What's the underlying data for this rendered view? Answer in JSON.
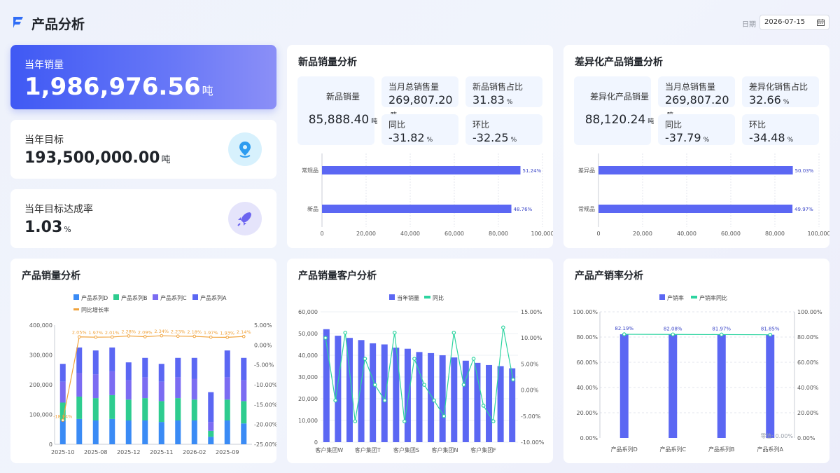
{
  "header": {
    "title": "产品分析",
    "date_label": "日期",
    "date_value": "2026-07-15"
  },
  "kpis": {
    "annual_sales": {
      "label": "当年销量",
      "value": "1,986,976.56",
      "unit": "吨"
    },
    "annual_target": {
      "label": "当年目标",
      "value": "193,500,000.00",
      "unit": "吨"
    },
    "target_rate": {
      "label": "当年目标达成率",
      "value": "1.03",
      "unit": "%"
    }
  },
  "new_product": {
    "title": "新品销量分析",
    "main": {
      "label": "新品销量",
      "value": "85,888.40",
      "unit": "吨"
    },
    "tiles": [
      {
        "label": "当月总销售量",
        "value": "269,807.20",
        "unit": "吨"
      },
      {
        "label": "新品销售占比",
        "value": "31.83",
        "unit": "%"
      },
      {
        "label": "同比",
        "value": "-31.82",
        "unit": "%"
      },
      {
        "label": "环比",
        "value": "-32.25",
        "unit": "%"
      }
    ]
  },
  "diff_product": {
    "title": "差异化产品销量分析",
    "main": {
      "label": "差异化产品销量",
      "value": "88,120.24",
      "unit": "吨"
    },
    "tiles": [
      {
        "label": "当月总销售量",
        "value": "269,807.20",
        "unit": "吨"
      },
      {
        "label": "差异化销售占比",
        "value": "32.66",
        "unit": "%"
      },
      {
        "label": "同比",
        "value": "-37.79",
        "unit": "%"
      },
      {
        "label": "环比",
        "value": "-34.48",
        "unit": "%"
      }
    ]
  },
  "bottom_titles": {
    "sales": "产品销量分析",
    "customers": "产品销量客户分析",
    "rate": "产品产销率分析"
  },
  "colors": {
    "accent": "#5b67f3",
    "blue": "#3a8bf5",
    "green": "#2ecc8f",
    "purple": "#7b6cf2",
    "indigo": "#5b67f3",
    "orange": "#f0a33c",
    "teal": "#2dd4a0"
  },
  "chart_data": [
    {
      "type": "bar",
      "id": "new-product-bar",
      "orientation": "horizontal",
      "categories": [
        "常规品",
        "新品"
      ],
      "values": [
        90000,
        85888.4
      ],
      "data_labels": [
        "51.24%",
        "48.76%"
      ],
      "xlim": [
        0,
        100000
      ],
      "x_ticks": [
        "0",
        "20,000",
        "40,000",
        "60,000",
        "80,000",
        "100,000"
      ]
    },
    {
      "type": "bar",
      "id": "diff-product-bar",
      "orientation": "horizontal",
      "categories": [
        "差异品",
        "常规品"
      ],
      "values": [
        88120.24,
        87965
      ],
      "data_labels": [
        "50.03%",
        "49.97%"
      ],
      "xlim": [
        0,
        100000
      ],
      "x_ticks": [
        "0",
        "20,000",
        "40,000",
        "60,000",
        "80,000",
        "100,000"
      ]
    },
    {
      "type": "bar",
      "id": "sales-stacked",
      "stacked": true,
      "legend": [
        "产品系列D",
        "产品系列B",
        "产品系列C",
        "产品系列A",
        "同比增长率"
      ],
      "x_tick_labels": [
        "2025-10",
        "2025-08",
        "2025-12",
        "2025-11",
        "2026-02",
        "2025-09"
      ],
      "ylim": [
        0,
        400000
      ],
      "y_ticks": [
        "0",
        "100,000",
        "200,000",
        "300,000",
        "400,000"
      ],
      "y2_ticks": [
        "5.00%",
        "0.00%",
        "-5.00%",
        "-10.00%",
        "-15.00%",
        "-20.00%",
        "-25.00%"
      ],
      "y2lim": [
        -25,
        5
      ],
      "series": [
        {
          "name": "产品系列D",
          "values": [
            80000,
            85000,
            80000,
            85000,
            80000,
            80000,
            75000,
            80000,
            80000,
            25000,
            80000,
            70000
          ]
        },
        {
          "name": "产品系列B",
          "values": [
            60000,
            75000,
            75000,
            80000,
            70000,
            75000,
            70000,
            75000,
            70000,
            20000,
            70000,
            75000
          ]
        },
        {
          "name": "产品系列C",
          "values": [
            70000,
            80000,
            80000,
            80000,
            65000,
            70000,
            65000,
            70000,
            70000,
            30000,
            75000,
            70000
          ]
        },
        {
          "name": "产品系列A",
          "values": [
            60000,
            85000,
            80000,
            80000,
            60000,
            65000,
            60000,
            65000,
            70000,
            100000,
            90000,
            75000
          ]
        },
        {
          "name": "同比增长率",
          "values": [
            -18.94,
            2.05,
            1.97,
            2.01,
            2.28,
            2.09,
            2.34,
            2.23,
            2.18,
            1.97,
            1.93,
            2.14
          ],
          "labels": [
            "-18.94%",
            "2.05%",
            "1.97%",
            "2.01%",
            "2.28%",
            "2.09%",
            "2.34%",
            "2.23%",
            "2.18%",
            "1.97%",
            "1.93%",
            "2.14%"
          ]
        }
      ]
    },
    {
      "type": "bar",
      "id": "customer-combo",
      "legend": [
        "当年销量",
        "同比"
      ],
      "x_tick_labels": [
        "客户集团W",
        "客户集团T",
        "客户集团S",
        "客户集团N",
        "客户集团F"
      ],
      "ylim": [
        0,
        60000
      ],
      "y_ticks": [
        "0",
        "10,000",
        "20,000",
        "30,000",
        "40,000",
        "50,000",
        "60,000"
      ],
      "y2lim": [
        -10,
        15
      ],
      "y2_ticks": [
        "15.00%",
        "10.00%",
        "5.00%",
        "0.00%",
        "-5.00%",
        "-10.00%"
      ],
      "series": [
        {
          "name": "当年销量",
          "values": [
            52000,
            49000,
            48000,
            47000,
            45500,
            45000,
            43500,
            43000,
            41500,
            41000,
            40000,
            39000,
            37500,
            36500,
            35500,
            35000,
            34000
          ]
        },
        {
          "name": "同比",
          "values": [
            10,
            -2,
            11,
            -6,
            6,
            1,
            -2,
            11,
            -6,
            6,
            1,
            -2,
            -5,
            11,
            1,
            6,
            -3,
            -6,
            12,
            2
          ]
        }
      ]
    },
    {
      "type": "bar",
      "id": "rate-combo",
      "legend": [
        "产销率",
        "产销率同比"
      ],
      "categories": [
        "产品系列D",
        "产品系列C",
        "产品系列B",
        "产品系列A"
      ],
      "values": [
        82.19,
        82.08,
        81.97,
        81.85
      ],
      "data_labels": [
        "82.19%",
        "82.08%",
        "81.97%",
        "81.85%"
      ],
      "ylim": [
        0,
        100
      ],
      "y_ticks": [
        "0.00%",
        "20.00%",
        "40.00%",
        "60.00%",
        "80.00%",
        "100.00%"
      ],
      "y2_ticks": [
        "0.00%",
        "20.00%",
        "40.00%",
        "60.00%",
        "80.00%",
        "100.00%"
      ],
      "line_values": [
        82.19,
        82.08,
        81.97,
        81.85
      ],
      "zero_note": "零值: 0.00%"
    }
  ]
}
